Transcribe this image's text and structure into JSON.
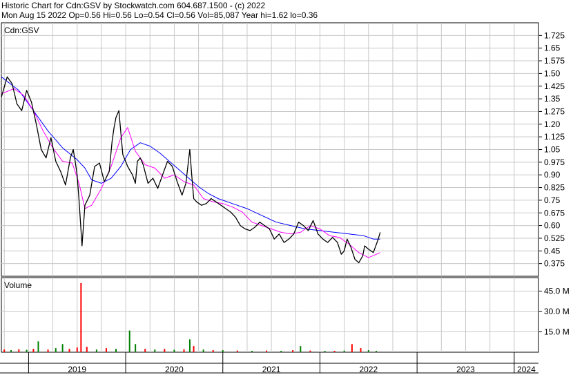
{
  "header": {
    "line1": "Historic Chart for Cdn:GSV by Stockwatch.com 604.687.1500 - (c) 2022",
    "line2": "Mon Aug 15 2022  Op=0.56  Hi=0.56  Lo=0.54  Cl=0.56  Vol=85,087  Year hi=1.62  lo=0.36"
  },
  "chart_data": [
    {
      "type": "line",
      "title": "Cdn:GSV",
      "y_tick_labels": [
        "1.725",
        "1.65",
        "1.575",
        "1.50",
        "1.425",
        "1.35",
        "1.275",
        "1.20",
        "1.125",
        "1.05",
        "0.975",
        "0.90",
        "0.825",
        "0.75",
        "0.675",
        "0.60",
        "0.525",
        "0.45",
        "0.375"
      ],
      "ylim": [
        0.3,
        1.8
      ],
      "x_tick_labels": [
        "2019",
        "2020",
        "2021",
        "2022",
        "2023",
        "2024"
      ],
      "xlim": [
        2018.72,
        2024.25
      ],
      "grid": true,
      "colors": {
        "price": "#000000",
        "ma_short": "#ff00ff",
        "ma_long": "#0000ff"
      },
      "series": [
        {
          "role": "price",
          "x": [
            2018.72,
            2018.78,
            2018.83,
            2018.88,
            2018.93,
            2018.98,
            2019.03,
            2019.08,
            2019.13,
            2019.18,
            2019.23,
            2019.28,
            2019.33,
            2019.38,
            2019.43,
            2019.46,
            2019.48,
            2019.5,
            2019.52,
            2019.55,
            2019.58,
            2019.63,
            2019.68,
            2019.73,
            2019.78,
            2019.83,
            2019.86,
            2019.88,
            2019.9,
            2019.93,
            2019.97,
            2020.02,
            2020.07,
            2020.1,
            2020.12,
            2020.15,
            2020.18,
            2020.23,
            2020.28,
            2020.33,
            2020.38,
            2020.43,
            2020.48,
            2020.53,
            2020.58,
            2020.62,
            2020.66,
            2020.68,
            2020.7,
            2020.73,
            2020.78,
            2020.83,
            2020.88,
            2020.93,
            2020.98,
            2021.03,
            2021.08,
            2021.13,
            2021.18,
            2021.23,
            2021.28,
            2021.33,
            2021.38,
            2021.43,
            2021.48,
            2021.53,
            2021.58,
            2021.63,
            2021.68,
            2021.73,
            2021.78,
            2021.83,
            2021.88,
            2021.93,
            2021.98,
            2022.03,
            2022.08,
            2022.13,
            2022.18,
            2022.22,
            2022.25,
            2022.28,
            2022.32,
            2022.36,
            2022.4,
            2022.44,
            2022.46,
            2022.5,
            2022.55,
            2022.6,
            2022.62
          ],
          "y": [
            1.36,
            1.48,
            1.44,
            1.32,
            1.28,
            1.4,
            1.33,
            1.2,
            1.05,
            1.0,
            1.12,
            0.98,
            0.92,
            0.84,
            1.0,
            1.05,
            0.98,
            0.9,
            0.75,
            0.48,
            0.72,
            0.78,
            0.95,
            0.97,
            0.86,
            0.92,
            1.1,
            1.18,
            1.24,
            1.28,
            1.02,
            0.95,
            0.9,
            0.85,
            0.98,
            1.0,
            0.96,
            0.85,
            0.88,
            0.82,
            0.9,
            0.98,
            0.95,
            0.86,
            0.78,
            0.85,
            1.05,
            0.9,
            0.76,
            0.74,
            0.72,
            0.73,
            0.76,
            0.74,
            0.72,
            0.7,
            0.68,
            0.65,
            0.6,
            0.58,
            0.57,
            0.59,
            0.62,
            0.6,
            0.58,
            0.52,
            0.55,
            0.5,
            0.52,
            0.55,
            0.62,
            0.6,
            0.57,
            0.63,
            0.55,
            0.52,
            0.5,
            0.53,
            0.5,
            0.43,
            0.45,
            0.52,
            0.47,
            0.4,
            0.38,
            0.42,
            0.48,
            0.46,
            0.44,
            0.52,
            0.56
          ]
        },
        {
          "role": "ma_short",
          "x": [
            2018.72,
            2018.85,
            2018.95,
            2019.05,
            2019.15,
            2019.25,
            2019.35,
            2019.45,
            2019.52,
            2019.58,
            2019.65,
            2019.75,
            2019.85,
            2019.95,
            2020.02,
            2020.1,
            2020.2,
            2020.3,
            2020.4,
            2020.5,
            2020.6,
            2020.7,
            2020.8,
            2020.9,
            2021.0,
            2021.1,
            2021.2,
            2021.3,
            2021.4,
            2021.5,
            2021.6,
            2021.7,
            2021.8,
            2021.9,
            2022.0,
            2022.1,
            2022.2,
            2022.3,
            2022.4,
            2022.5,
            2022.62
          ],
          "y": [
            1.38,
            1.41,
            1.37,
            1.28,
            1.16,
            1.06,
            0.98,
            0.97,
            0.85,
            0.7,
            0.72,
            0.82,
            0.95,
            1.12,
            1.18,
            1.04,
            0.96,
            0.94,
            0.88,
            0.9,
            0.86,
            0.84,
            0.76,
            0.74,
            0.73,
            0.71,
            0.68,
            0.62,
            0.6,
            0.58,
            0.56,
            0.55,
            0.56,
            0.6,
            0.58,
            0.54,
            0.53,
            0.49,
            0.44,
            0.41,
            0.44
          ]
        },
        {
          "role": "ma_long",
          "x": [
            2018.72,
            2018.9,
            2019.05,
            2019.2,
            2019.35,
            2019.5,
            2019.58,
            2019.65,
            2019.75,
            2019.85,
            2019.95,
            2020.05,
            2020.15,
            2020.25,
            2020.35,
            2020.45,
            2020.55,
            2020.65,
            2020.75,
            2020.85,
            2020.95,
            2021.1,
            2021.25,
            2021.4,
            2021.55,
            2021.7,
            2021.85,
            2022.0,
            2022.15,
            2022.3,
            2022.45,
            2022.55,
            2022.62
          ],
          "y": [
            1.48,
            1.4,
            1.28,
            1.16,
            1.06,
            0.99,
            0.94,
            0.87,
            0.85,
            0.88,
            0.95,
            1.05,
            1.09,
            1.07,
            1.03,
            0.98,
            0.93,
            0.88,
            0.83,
            0.79,
            0.76,
            0.73,
            0.7,
            0.66,
            0.62,
            0.6,
            0.58,
            0.57,
            0.56,
            0.55,
            0.54,
            0.52,
            0.52
          ]
        }
      ]
    },
    {
      "type": "bar",
      "title": "Volume",
      "y_tick_labels": [
        "45.0 M",
        "30.0 M",
        "15.0 M"
      ],
      "ylim": [
        0,
        55
      ],
      "xlim": [
        2018.72,
        2024.25
      ],
      "grid": true,
      "colors": {
        "up": "#008000",
        "down": "#ff0000"
      },
      "bars": [
        {
          "x": 2018.75,
          "v": 2.0,
          "c": "down"
        },
        {
          "x": 2018.82,
          "v": 1.5,
          "c": "up"
        },
        {
          "x": 2018.9,
          "v": 2.2,
          "c": "down"
        },
        {
          "x": 2018.98,
          "v": 1.8,
          "c": "up"
        },
        {
          "x": 2019.05,
          "v": 2.5,
          "c": "down"
        },
        {
          "x": 2019.1,
          "v": 8.0,
          "c": "up"
        },
        {
          "x": 2019.2,
          "v": 2.0,
          "c": "down"
        },
        {
          "x": 2019.28,
          "v": 3.0,
          "c": "up"
        },
        {
          "x": 2019.35,
          "v": 6.0,
          "c": "up"
        },
        {
          "x": 2019.42,
          "v": 2.5,
          "c": "down"
        },
        {
          "x": 2019.5,
          "v": 3.5,
          "c": "down"
        },
        {
          "x": 2019.54,
          "v": 51.0,
          "c": "down"
        },
        {
          "x": 2019.6,
          "v": 4.0,
          "c": "down"
        },
        {
          "x": 2019.7,
          "v": 2.0,
          "c": "up"
        },
        {
          "x": 2019.8,
          "v": 3.0,
          "c": "down"
        },
        {
          "x": 2019.9,
          "v": 2.5,
          "c": "up"
        },
        {
          "x": 2020.04,
          "v": 16.0,
          "c": "up"
        },
        {
          "x": 2020.1,
          "v": 6.0,
          "c": "up"
        },
        {
          "x": 2020.2,
          "v": 2.5,
          "c": "down"
        },
        {
          "x": 2020.3,
          "v": 2.0,
          "c": "up"
        },
        {
          "x": 2020.4,
          "v": 2.5,
          "c": "down"
        },
        {
          "x": 2020.5,
          "v": 1.8,
          "c": "up"
        },
        {
          "x": 2020.6,
          "v": 2.2,
          "c": "down"
        },
        {
          "x": 2020.66,
          "v": 9.5,
          "c": "up"
        },
        {
          "x": 2020.7,
          "v": 4.5,
          "c": "down"
        },
        {
          "x": 2020.8,
          "v": 2.0,
          "c": "up"
        },
        {
          "x": 2020.9,
          "v": 1.5,
          "c": "down"
        },
        {
          "x": 2021.0,
          "v": 1.5,
          "c": "up"
        },
        {
          "x": 2021.15,
          "v": 1.2,
          "c": "down"
        },
        {
          "x": 2021.3,
          "v": 1.0,
          "c": "up"
        },
        {
          "x": 2021.45,
          "v": 1.2,
          "c": "down"
        },
        {
          "x": 2021.6,
          "v": 1.0,
          "c": "up"
        },
        {
          "x": 2021.72,
          "v": 1.5,
          "c": "down"
        },
        {
          "x": 2021.8,
          "v": 4.5,
          "c": "up"
        },
        {
          "x": 2021.9,
          "v": 1.2,
          "c": "down"
        },
        {
          "x": 2022.05,
          "v": 1.0,
          "c": "up"
        },
        {
          "x": 2022.15,
          "v": 1.0,
          "c": "down"
        },
        {
          "x": 2022.25,
          "v": 1.2,
          "c": "up"
        },
        {
          "x": 2022.33,
          "v": 6.0,
          "c": "down"
        },
        {
          "x": 2022.42,
          "v": 3.0,
          "c": "down"
        },
        {
          "x": 2022.5,
          "v": 1.5,
          "c": "up"
        },
        {
          "x": 2022.58,
          "v": 1.0,
          "c": "up"
        }
      ]
    }
  ]
}
